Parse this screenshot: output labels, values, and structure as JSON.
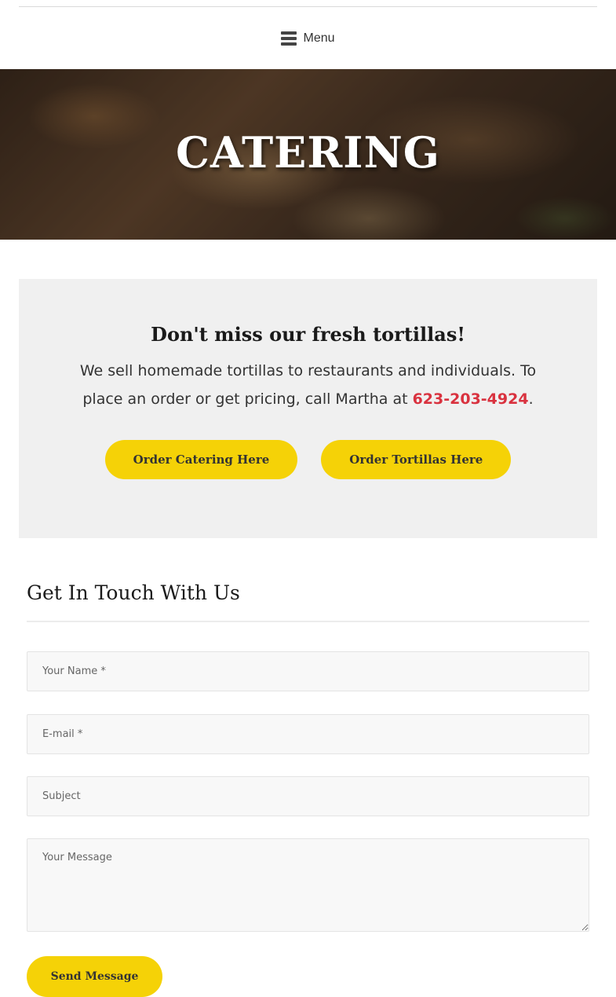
{
  "header": {
    "menu_label": "Menu",
    "menu_icon": "hamburger-icon"
  },
  "hero": {
    "title": "CATERING"
  },
  "promo": {
    "heading": "Don't miss our fresh tortillas!",
    "text_before_phone": "We sell homemade tortillas to restaurants and individuals. To place an order or get pricing, call Martha at ",
    "phone": "623-203-4924",
    "text_after_phone": ".",
    "phone_color": "#d9323f",
    "buttons": [
      {
        "label": "Order Catering Here"
      },
      {
        "label": "Order Tortillas Here"
      }
    ],
    "button_color": "#f5d207"
  },
  "contact": {
    "title": "Get In Touch With Us",
    "fields": {
      "name_placeholder": "Your Name *",
      "email_placeholder": "E-mail *",
      "subject_placeholder": "Subject",
      "message_placeholder": "Your Message"
    },
    "submit_label": "Send Message"
  }
}
